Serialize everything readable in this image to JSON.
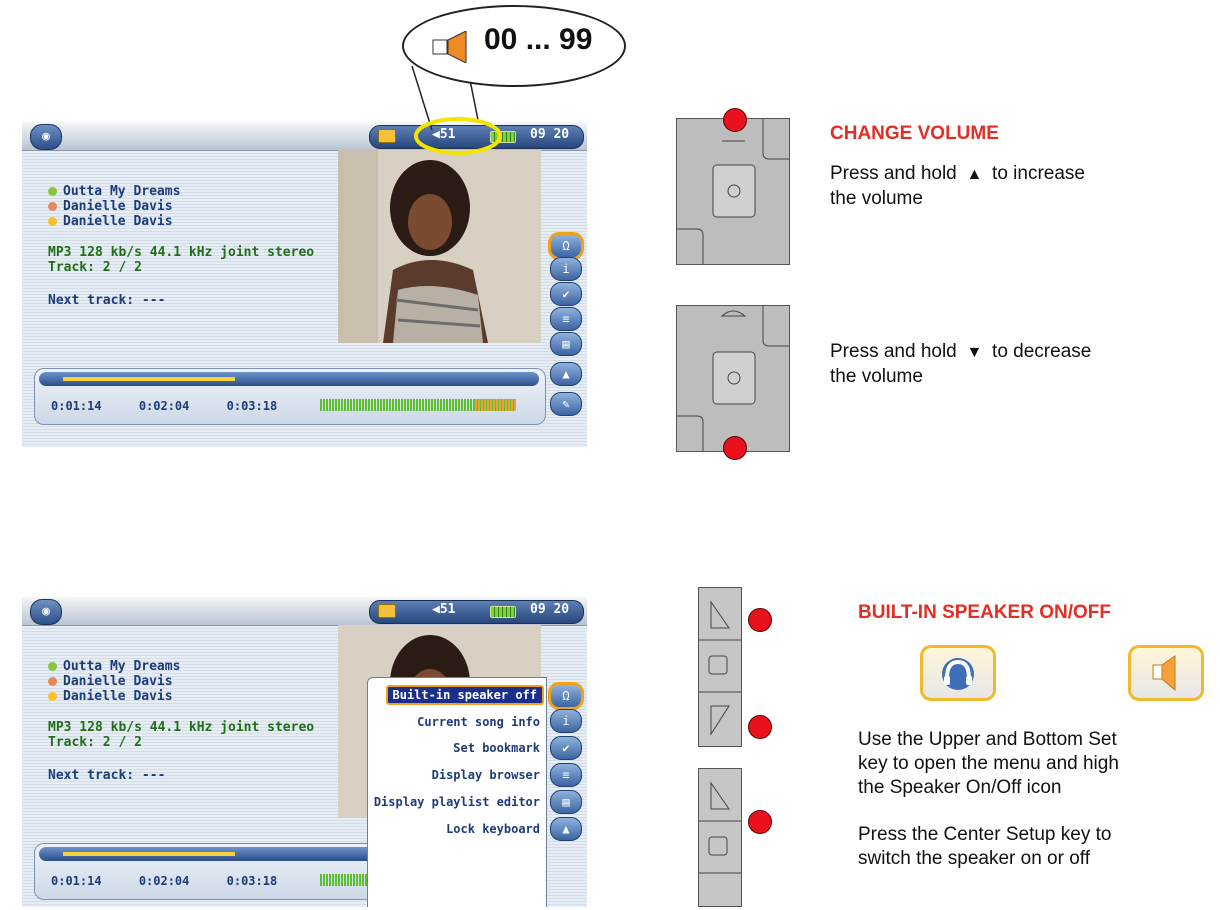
{
  "callout": {
    "label": "00 ... 99"
  },
  "player": {
    "volume": "51",
    "clock": "09 20",
    "song_title": "Outta My Dreams",
    "artist": "Danielle Davis",
    "album": "Danielle Davis",
    "format": "MP3 128  kb/s  44.1 kHz joint stereo",
    "track": "Track: 2 / 2",
    "next_track": "Next track: ---",
    "time_elapsed": "0:01:14",
    "time_remaining": "0:02:04",
    "time_total": "0:03:18",
    "progress": 0.38
  },
  "menu": {
    "items": [
      "Built-in speaker off",
      "Current song info",
      "Set bookmark",
      "Display browser",
      "Display playlist editor",
      "Lock keyboard"
    ]
  },
  "volume_section": {
    "heading": "CHANGE VOLUME",
    "increase_line1": "Press and hold",
    "increase_line1_end": "to increase",
    "increase_line2": "the volume",
    "decrease_line1": "Press and hold",
    "decrease_line1_end": "to decrease",
    "decrease_line2": "the volume"
  },
  "speaker_section": {
    "heading": "BUILT-IN SPEAKER ON/OFF",
    "text1_line1": "Use the Upper and Bottom Set",
    "text1_line2": "key to open the menu and high",
    "text1_line3": "the Speaker On/Off icon",
    "text2_line1": "Press the Center Setup key to",
    "text2_line2": "switch the speaker on or off"
  },
  "colors": {
    "accent_red": "#e62d24",
    "highlight_yellow": "#f5e400",
    "screen_blue": "#1c3b7a"
  }
}
